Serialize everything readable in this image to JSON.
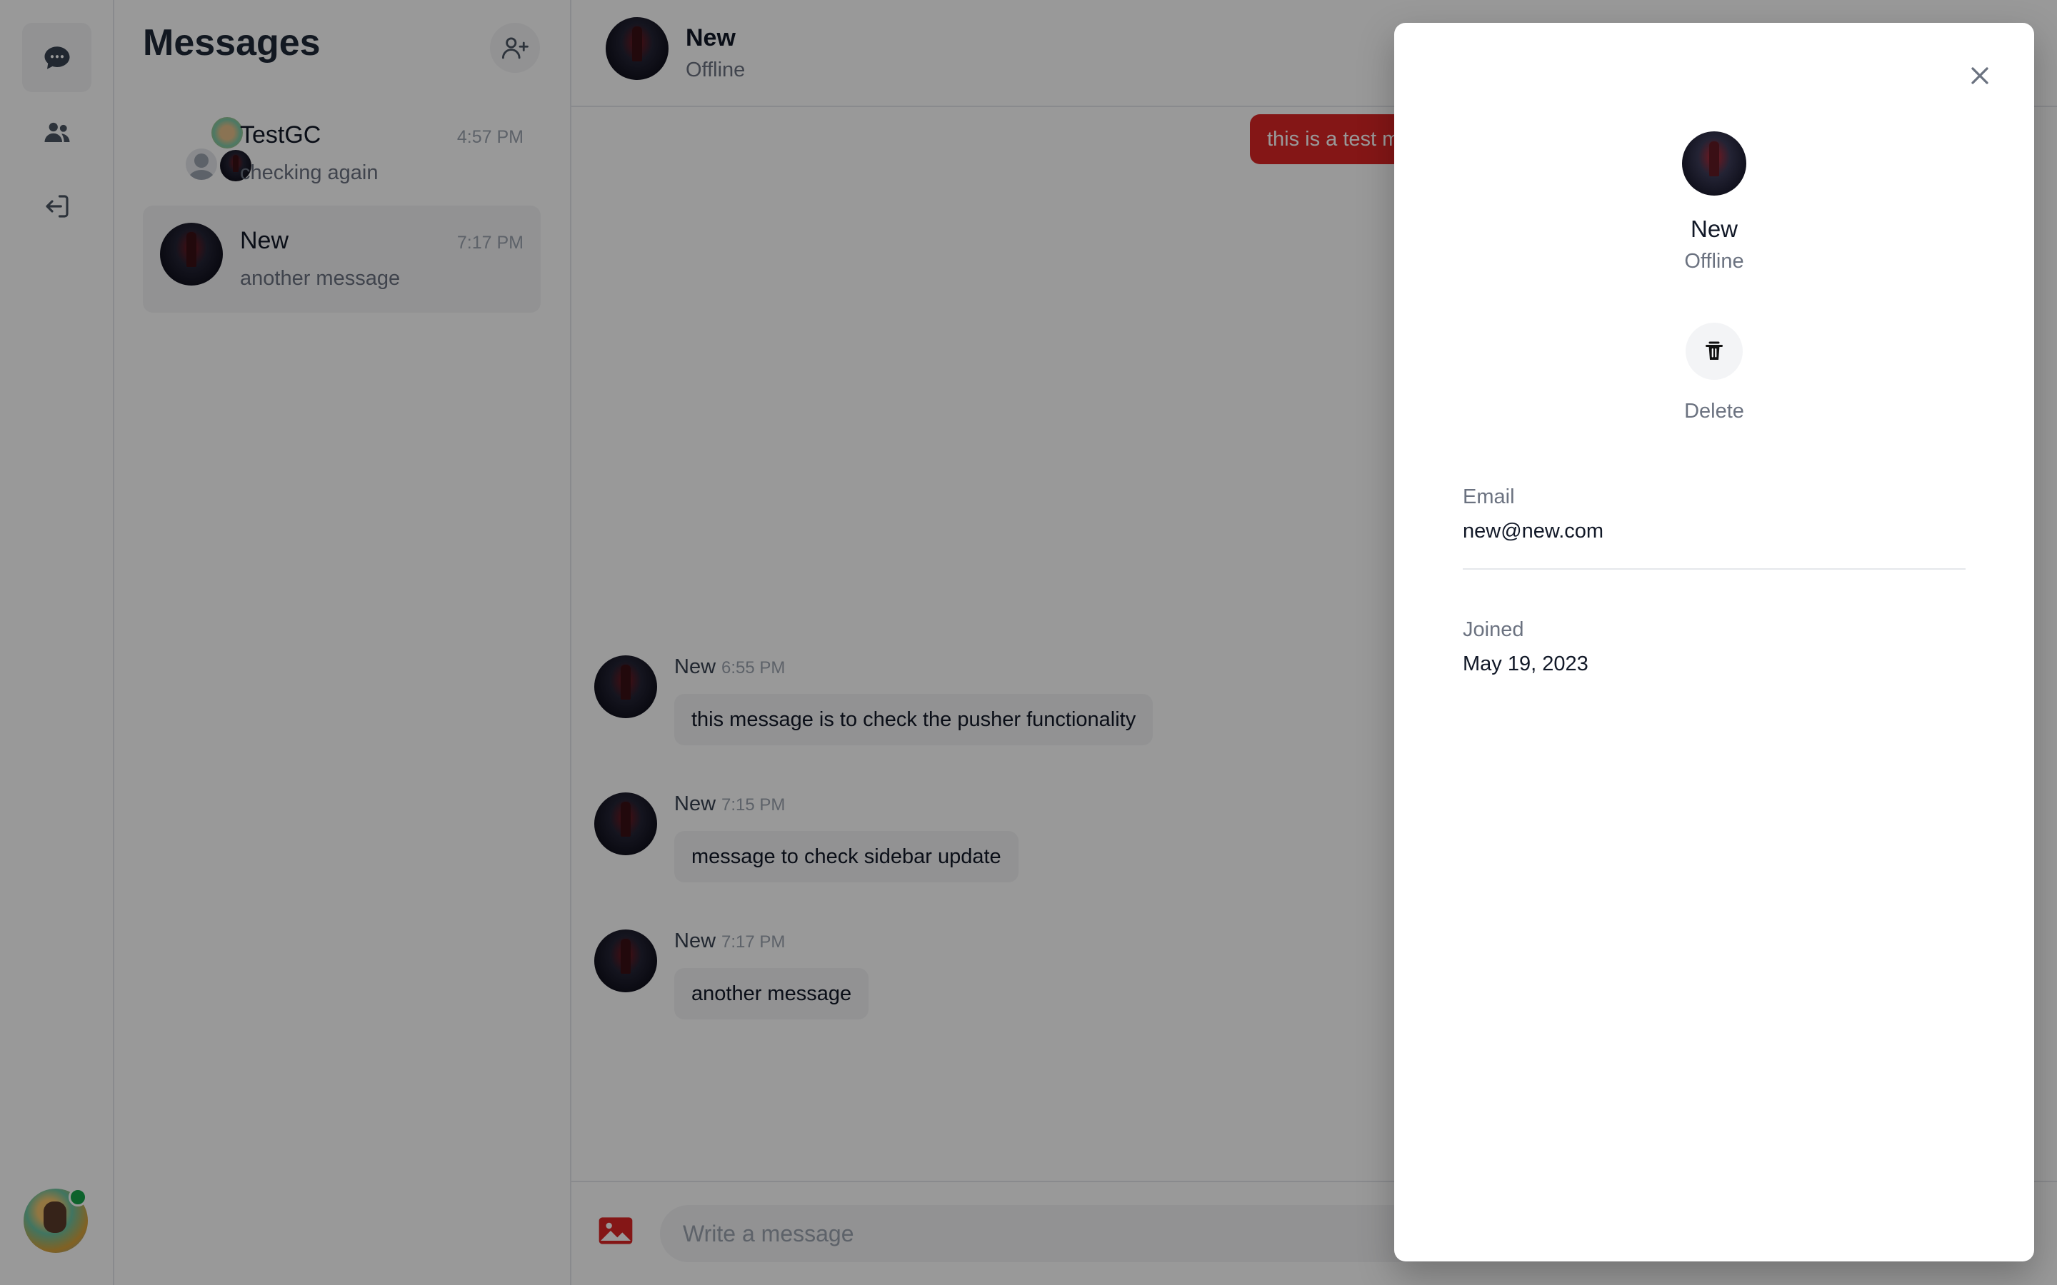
{
  "sidebar": {
    "icons": [
      "chat-bubble-icon",
      "users-icon",
      "logout-icon"
    ]
  },
  "conversations": {
    "title": "Messages",
    "items": [
      {
        "name": "TestGC",
        "time": "4:57 PM",
        "preview": "checking again"
      },
      {
        "name": "New",
        "time": "7:17 PM",
        "preview": "another message"
      }
    ]
  },
  "chat": {
    "header": {
      "name": "New",
      "status": "Offline"
    },
    "my_message": "this is a test m",
    "messages": [
      {
        "sender": "New",
        "time": "6:55 PM",
        "text": "this message is to check the pusher functionality"
      },
      {
        "sender": "New",
        "time": "7:15 PM",
        "text": "message to check sidebar update"
      },
      {
        "sender": "New",
        "time": "7:17 PM",
        "text": "another message"
      }
    ],
    "composer": {
      "placeholder": "Write a message"
    }
  },
  "profile": {
    "name": "New",
    "status": "Offline",
    "delete_label": "Delete",
    "email_label": "Email",
    "email": "new@new.com",
    "joined_label": "Joined",
    "joined": "May 19, 2023"
  },
  "colors": {
    "accent": "#dc2626",
    "online": "#16a34a",
    "overlay": "rgba(0,0,0,0.4)"
  }
}
